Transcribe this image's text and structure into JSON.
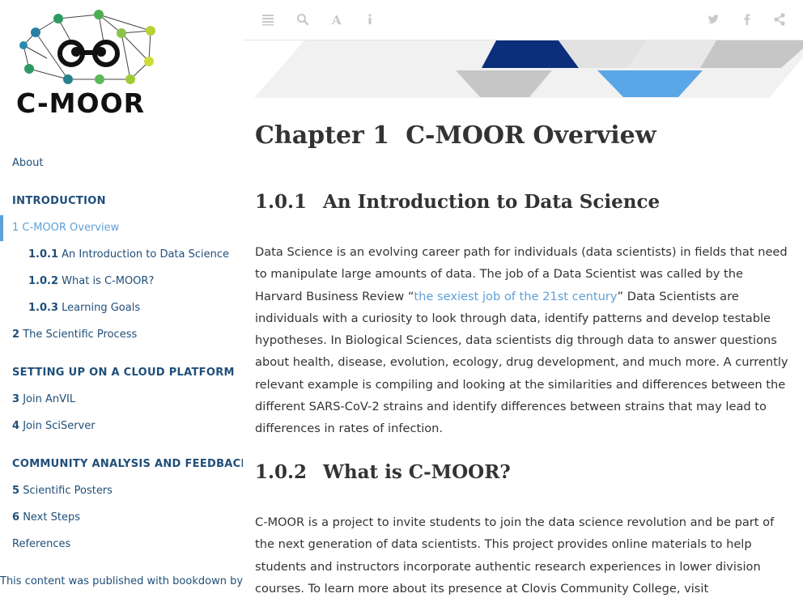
{
  "logo": {
    "text": "C-MOOR"
  },
  "sidebar": {
    "about": "About",
    "sections": [
      {
        "title": "INTRODUCTION",
        "items": [
          {
            "num": "1",
            "label": "C-MOOR Overview",
            "active": true
          },
          {
            "num": "1.0.1",
            "label": "An Introduction to Data Science"
          },
          {
            "num": "1.0.2",
            "label": "What is C-MOOR?"
          },
          {
            "num": "1.0.3",
            "label": "Learning Goals"
          },
          {
            "num": "2",
            "label": "The Scientific Process"
          }
        ]
      },
      {
        "title": "SETTING UP ON A CLOUD PLATFORM",
        "items": [
          {
            "num": "3",
            "label": "Join AnVIL"
          },
          {
            "num": "4",
            "label": "Join SciServer"
          }
        ]
      },
      {
        "title": "COMMUNITY ANALYSIS AND FEEDBACK",
        "items": [
          {
            "num": "5",
            "label": "Scientific Posters"
          },
          {
            "num": "6",
            "label": "Next Steps"
          }
        ]
      }
    ],
    "references": "References",
    "published": "This content was published with bookdown by:"
  },
  "toolbar": {
    "left_icons": [
      "toc-toggle-icon",
      "search-icon",
      "font-settings-icon",
      "info-icon"
    ],
    "right_icons": [
      "twitter-icon",
      "facebook-icon",
      "share-icon"
    ],
    "colors": {
      "icon": "#c8c8c8"
    }
  },
  "main": {
    "chapter_num": "Chapter 1",
    "chapter_title": "C-MOOR Overview",
    "sec1_num": "1.0.1",
    "sec1_title": "An Introduction to Data Science",
    "p1_before": "Data Science is an evolving career path for individuals (data scientists) in fields that need to manipulate large amounts of data. The job of a Data Scientist was called by the Harvard Business Review “",
    "p1_link": "the sexiest job of the 21st century",
    "p1_after": "” Data Scientists are individuals with a curiosity to look through data, identify patterns and develop testable hypotheses. In Biological Sciences, data scientists dig through data to answer questions about health, disease, evolution, ecology, drug development, and much more. A currently relevant example is compiling and looking at the similarities and differences between the different SARS-CoV-2 strains and identify differences between strains that may lead to differences in rates of infection.",
    "sec2_num": "1.0.2",
    "sec2_title": "What is C-MOOR?",
    "p2": "C-MOOR is a project to invite students to join the data science revolution and be part of the next generation of data scientists. This project provides online materials to help students and instructors incorporate authentic research experiences in lower division courses. To learn more about its presence at Clovis Community College, visit"
  },
  "colors": {
    "nav_text": "#1f4e79",
    "accent": "#5ea0d8",
    "banner_dark": "#0b2f7a",
    "banner_light": "#5aa6e6",
    "banner_gray": "#c6c6c6"
  }
}
